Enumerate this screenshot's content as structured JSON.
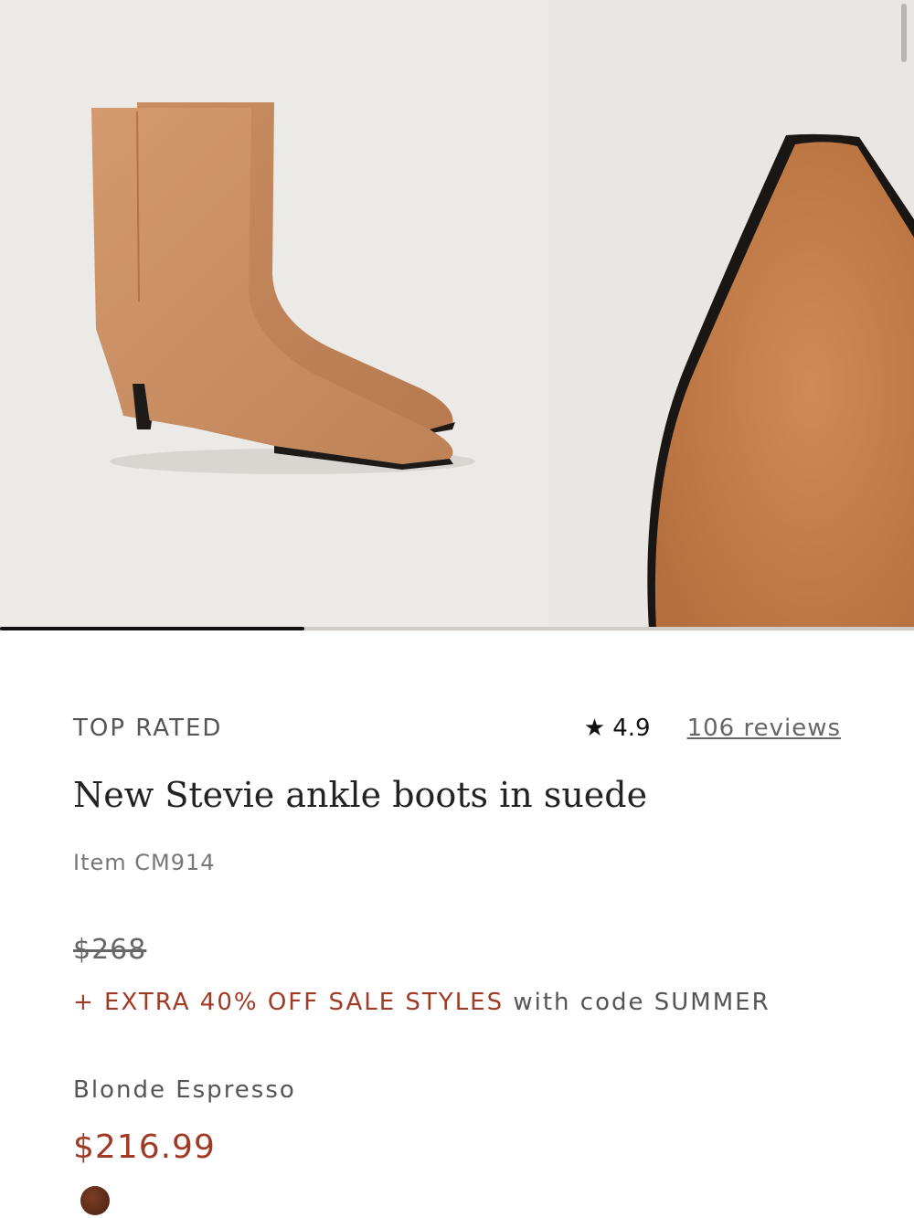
{
  "gallery": {
    "current_slide": 1,
    "total_slides": 3,
    "image_alt_main": "",
    "image_alt_next": ""
  },
  "product": {
    "badge": "TOP RATED",
    "rating_star": "★",
    "rating_value": "4.9",
    "reviews_link": "106 reviews",
    "title": "New Stevie ankle boots in suede",
    "item_number": "Item CM914",
    "original_price": "$268",
    "promo_accent": "+ EXTRA 40% OFF SALE STYLES",
    "promo_rest": " with code SUMMER",
    "color_name": "Blonde Espresso",
    "sale_price": "$216.99"
  },
  "colors": {
    "accent": "#a03a25",
    "suede": "#c58a5f",
    "swatch": "#5a2a17"
  }
}
